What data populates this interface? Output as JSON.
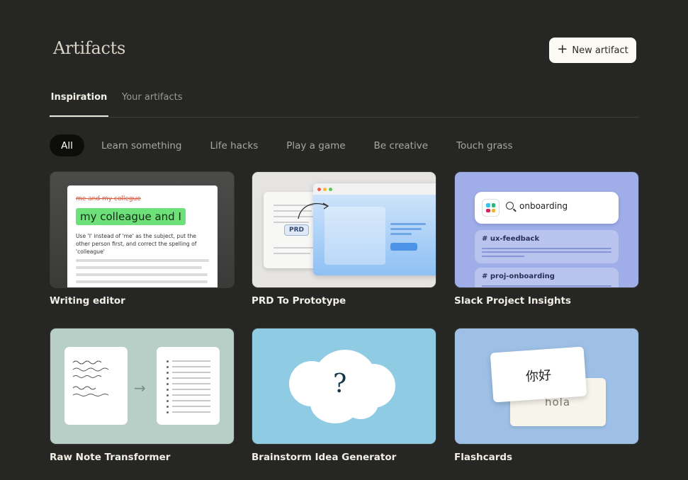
{
  "header": {
    "title": "Artifacts",
    "new_button_label": "New artifact",
    "new_button_icon": "plus-icon"
  },
  "tabs": [
    {
      "label": "Inspiration",
      "active": true
    },
    {
      "label": "Your artifacts",
      "active": false
    }
  ],
  "filters": [
    {
      "label": "All",
      "active": true
    },
    {
      "label": "Learn something"
    },
    {
      "label": "Life hacks"
    },
    {
      "label": "Play a game"
    },
    {
      "label": "Be creative"
    },
    {
      "label": "Touch grass"
    }
  ],
  "cards": [
    {
      "title": "Writing editor",
      "preview": {
        "strike": "me and my collegue",
        "highlight": "my colleague and I",
        "note": "Use 'I' instead of 'me' as the subject, put the other person first, and correct the spelling of 'colleague'"
      }
    },
    {
      "title": "PRD To Prototype",
      "preview": {
        "tag": "PRD"
      }
    },
    {
      "title": "Slack Project Insights",
      "preview": {
        "search": "onboarding",
        "channels": [
          "# ux-feedback",
          "# proj-onboarding"
        ]
      }
    },
    {
      "title": "Raw Note Transformer",
      "preview": {}
    },
    {
      "title": "Brainstorm Idea Generator",
      "preview": {
        "symbol": "?"
      }
    },
    {
      "title": "Flashcards",
      "preview": {
        "front": "你好",
        "back": "hola"
      }
    }
  ],
  "colors": {
    "background": "#262624",
    "button_bg": "#fbf9f3",
    "chip_active_bg": "#0d0d0c",
    "highlight_green": "#6ee07a",
    "strike_red": "#d8553a"
  }
}
